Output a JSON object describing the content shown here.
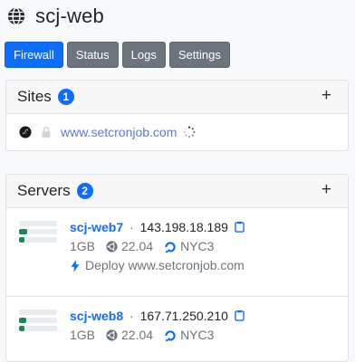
{
  "app": {
    "title": "scj-web"
  },
  "tabs": [
    {
      "label": "Firewall",
      "active": true
    },
    {
      "label": "Status",
      "active": false
    },
    {
      "label": "Logs",
      "active": false
    },
    {
      "label": "Settings",
      "active": false
    }
  ],
  "sites": {
    "title": "Sites",
    "count": "1",
    "items": [
      {
        "domain": "www.setcronjob.com",
        "loading": true,
        "icons": [
          "symfony-icon",
          "lock-icon"
        ]
      }
    ]
  },
  "servers": {
    "title": "Servers",
    "count": "2",
    "items": [
      {
        "name": "scj-web7",
        "ip": "143.198.18.189",
        "memory": "1GB",
        "os": "22.04",
        "region": "NYC3",
        "deploy": "Deploy www.setcronjob.com",
        "usage": [
          0.0,
          0.22,
          0.14
        ]
      },
      {
        "name": "scj-web8",
        "ip": "167.71.250.210",
        "memory": "1GB",
        "os": "22.04",
        "region": "NYC3",
        "usage": [
          0.0,
          0.2,
          0.14
        ]
      }
    ]
  },
  "colors": {
    "primary": "#0d6efd",
    "secondary": "#6c757d",
    "success": "#198754"
  }
}
